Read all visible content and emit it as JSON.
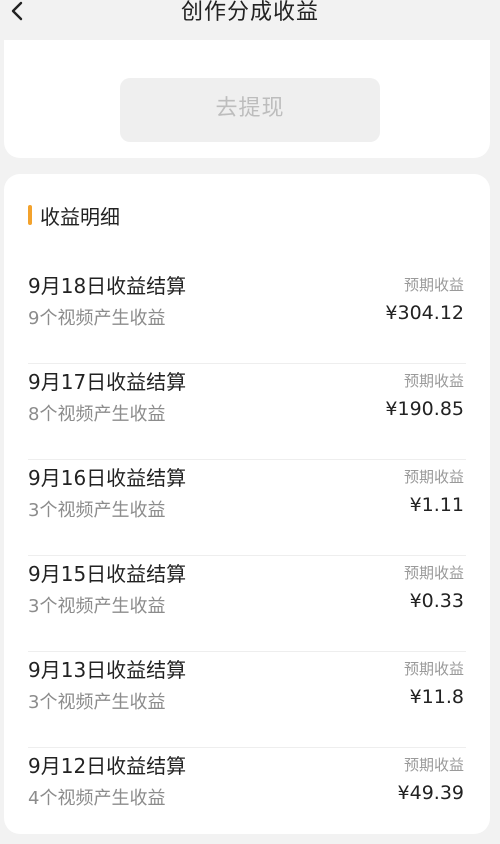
{
  "header": {
    "title": "创作分成收益",
    "back_icon": "chevron-left-icon"
  },
  "withdraw": {
    "label": "去提现"
  },
  "details": {
    "section_title": "收益明细",
    "accent_color": "#f3a22c",
    "rows": [
      {
        "title": "9月18日收益结算",
        "subtitle": "9个视频产生收益",
        "label": "预期收益",
        "amount": "¥304.12"
      },
      {
        "title": "9月17日收益结算",
        "subtitle": "8个视频产生收益",
        "label": "预期收益",
        "amount": "¥190.85"
      },
      {
        "title": "9月16日收益结算",
        "subtitle": "3个视频产生收益",
        "label": "预期收益",
        "amount": "¥1.11"
      },
      {
        "title": "9月15日收益结算",
        "subtitle": "3个视频产生收益",
        "label": "预期收益",
        "amount": "¥0.33"
      },
      {
        "title": "9月13日收益结算",
        "subtitle": "3个视频产生收益",
        "label": "预期收益",
        "amount": "¥11.8"
      },
      {
        "title": "9月12日收益结算",
        "subtitle": "4个视频产生收益",
        "label": "预期收益",
        "amount": "¥49.39"
      }
    ]
  }
}
